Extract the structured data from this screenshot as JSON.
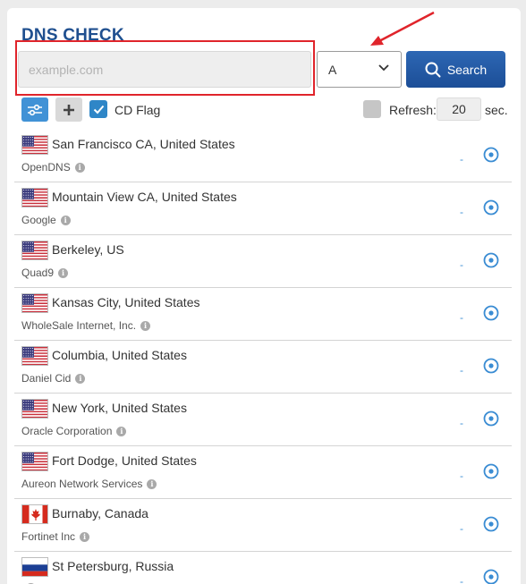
{
  "title": "DNS CHECK",
  "search": {
    "placeholder": "example.com",
    "value": ""
  },
  "record_type": {
    "selected": "A"
  },
  "search_button": {
    "label": "Search"
  },
  "options": {
    "cd_flag_label": "CD Flag",
    "cd_flag_checked": true,
    "refresh_label": "Refresh:",
    "refresh_checked": false,
    "refresh_value": "20",
    "refresh_unit": "sec."
  },
  "servers": [
    {
      "location": "San Francisco CA, United States",
      "provider": "OpenDNS",
      "flag": "us-flag-icon",
      "result": "-"
    },
    {
      "location": "Mountain View CA, United States",
      "provider": "Google",
      "flag": "us-flag-icon",
      "result": "-"
    },
    {
      "location": "Berkeley, US",
      "provider": "Quad9",
      "flag": "us-flag-icon",
      "result": "-"
    },
    {
      "location": "Kansas City, United States",
      "provider": "WholeSale Internet, Inc.",
      "flag": "us-flag-icon",
      "result": "-"
    },
    {
      "location": "Columbia, United States",
      "provider": "Daniel Cid",
      "flag": "us-flag-icon",
      "result": "-"
    },
    {
      "location": "New York, United States",
      "provider": "Oracle Corporation",
      "flag": "us-flag-icon",
      "result": "-"
    },
    {
      "location": "Fort Dodge, United States",
      "provider": "Aureon Network Services",
      "flag": "us-flag-icon",
      "result": "-"
    },
    {
      "location": "Burnaby, Canada",
      "provider": "Fortinet Inc",
      "flag": "canada-flag-icon",
      "result": "-"
    },
    {
      "location": "St Petersburg, Russia",
      "provider": "",
      "flag": "russia-flag-icon",
      "result": "-"
    }
  ],
  "colors": {
    "title": "#1f4f8f",
    "search_button": "#1c4e97",
    "accent": "#4192d6",
    "annotation": "#e0242b"
  }
}
